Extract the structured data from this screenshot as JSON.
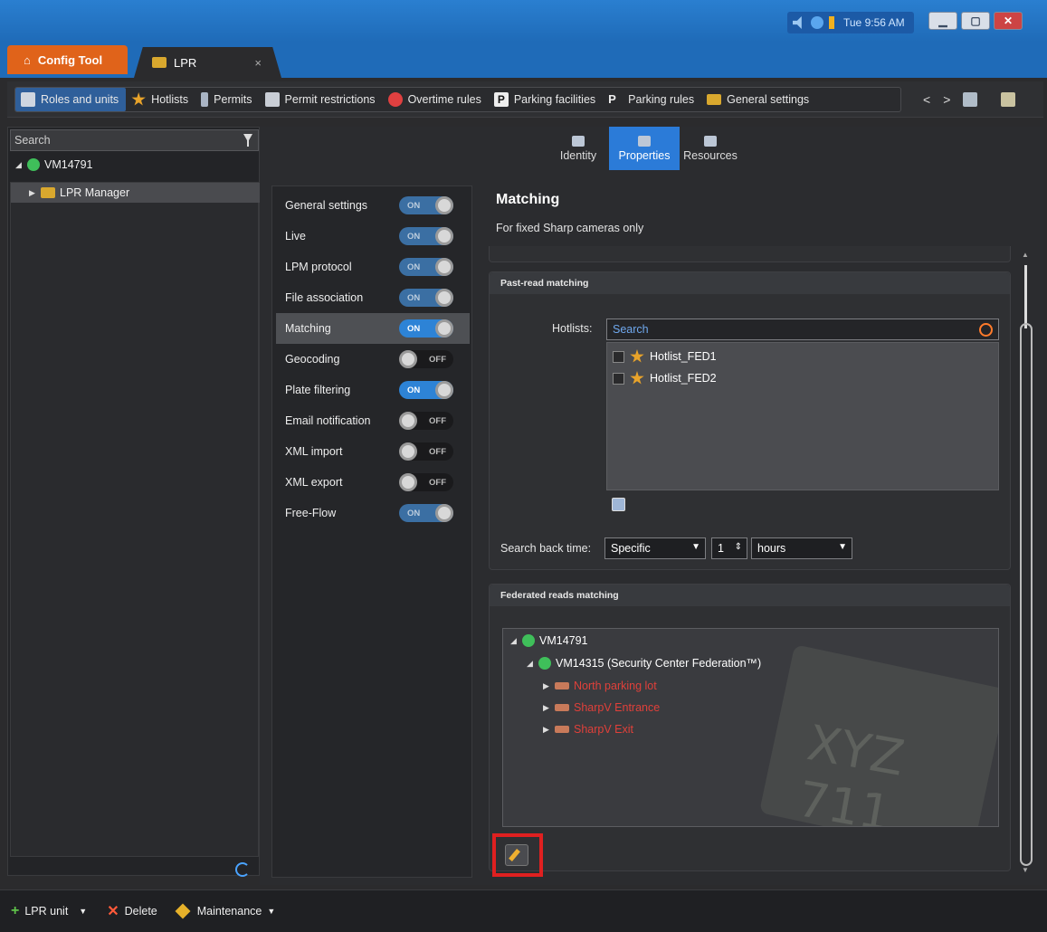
{
  "tray": {
    "time": "Tue 9:56 AM"
  },
  "tabs": {
    "config": "Config Tool",
    "lpr": "LPR",
    "close": "×"
  },
  "toolbar": {
    "items": [
      "Roles and units",
      "Hotlists",
      "Permits",
      "Permit restrictions",
      "Overtime rules",
      "Parking facilities",
      "Parking rules",
      "General settings"
    ],
    "nav_prev": "<",
    "nav_next": ">"
  },
  "left": {
    "search_placeholder": "Search",
    "tree": [
      {
        "label": "VM14791"
      },
      {
        "label": "LPR Manager"
      }
    ]
  },
  "view_tabs": [
    "Identity",
    "Properties",
    "Resources"
  ],
  "toggles": [
    {
      "label": "General settings",
      "state": "ON"
    },
    {
      "label": "Live",
      "state": "ON"
    },
    {
      "label": "LPM protocol",
      "state": "ON"
    },
    {
      "label": "File association",
      "state": "ON"
    },
    {
      "label": "Matching",
      "state": "ON"
    },
    {
      "label": "Geocoding",
      "state": "OFF"
    },
    {
      "label": "Plate filtering",
      "state": "ON"
    },
    {
      "label": "Email notification",
      "state": "OFF"
    },
    {
      "label": "XML import",
      "state": "OFF"
    },
    {
      "label": "XML export",
      "state": "OFF"
    },
    {
      "label": "Free-Flow",
      "state": "ON"
    }
  ],
  "matching": {
    "title": "Matching",
    "subtitle": "For fixed Sharp cameras only",
    "past_read": {
      "header": "Past-read matching",
      "hotlists_label": "Hotlists:",
      "search_placeholder": "Search",
      "hotlists": [
        "Hotlist_FED1",
        "Hotlist_FED2"
      ],
      "search_back_label": "Search back time:",
      "mode": "Specific",
      "amount": "1",
      "unit": "hours"
    },
    "federated": {
      "header": "Federated reads matching",
      "root": "VM14791",
      "federation": "VM14315 (Security Center Federation™)",
      "units": [
        "North parking lot",
        "SharpV Entrance",
        "SharpV Exit"
      ],
      "plate_text": "XYZ 711"
    }
  },
  "bottom": {
    "add": "LPR unit",
    "delete": "Delete",
    "maintenance": "Maintenance"
  },
  "colors": {
    "accent": "#2b7bd8",
    "brand_orange": "#e0631a",
    "unit_red": "#e0403a",
    "highlight": "#e02020"
  }
}
